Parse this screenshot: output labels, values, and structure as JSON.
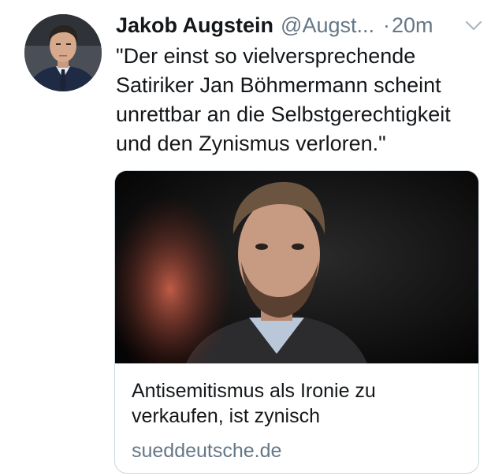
{
  "tweet": {
    "author_name": "Jakob Augstein",
    "author_handle": "@Augst...",
    "separator": "·",
    "time": "20m",
    "text": "\"Der einst so vielversprechende Satiriker Jan Böhmermann scheint unrettbar an die Selbstgerechtigkeit und den Zynismus verloren.\""
  },
  "link_card": {
    "title": "Antisemitismus als Ironie zu verkaufen, ist zynisch",
    "domain": "sueddeutsche.de"
  },
  "icons": {
    "menu": "chevron-down-icon"
  },
  "colors": {
    "text_primary": "#14171a",
    "text_secondary": "#657786",
    "card_border": "#ccd6dd"
  }
}
